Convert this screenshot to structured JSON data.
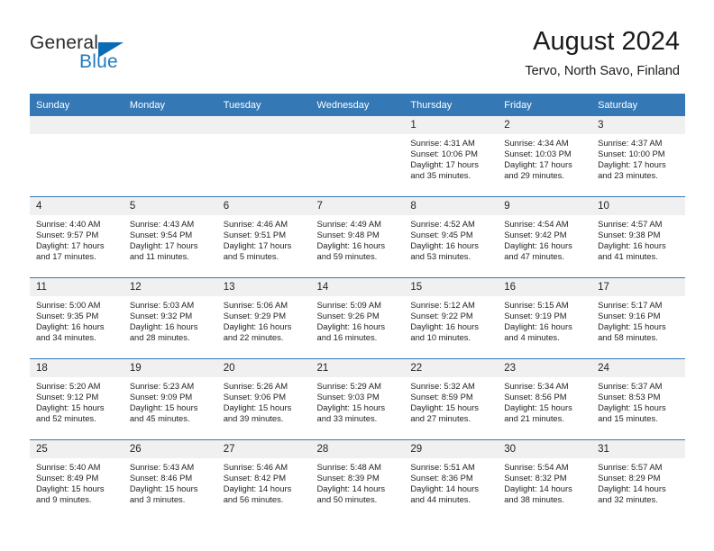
{
  "brand": {
    "name_line1": "General",
    "name_line2": "Blue",
    "accent_color": "#0a6cb5"
  },
  "header": {
    "title": "August 2024",
    "location": "Tervo, North Savo, Finland"
  },
  "theme": {
    "header_blue": "#3478b6",
    "daynum_background": "#f0f0f0",
    "text_color": "#231f20"
  },
  "weekday_headers": [
    "Sunday",
    "Monday",
    "Tuesday",
    "Wednesday",
    "Thursday",
    "Friday",
    "Saturday"
  ],
  "weeks": [
    [
      {
        "day": "",
        "empty": true,
        "sunrise": "",
        "sunset": "",
        "daylight_line1": "",
        "daylight_line2": ""
      },
      {
        "day": "",
        "empty": true,
        "sunrise": "",
        "sunset": "",
        "daylight_line1": "",
        "daylight_line2": ""
      },
      {
        "day": "",
        "empty": true,
        "sunrise": "",
        "sunset": "",
        "daylight_line1": "",
        "daylight_line2": ""
      },
      {
        "day": "",
        "empty": true,
        "sunrise": "",
        "sunset": "",
        "daylight_line1": "",
        "daylight_line2": ""
      },
      {
        "day": "1",
        "sunrise": "Sunrise: 4:31 AM",
        "sunset": "Sunset: 10:06 PM",
        "daylight_line1": "Daylight: 17 hours",
        "daylight_line2": "and 35 minutes."
      },
      {
        "day": "2",
        "sunrise": "Sunrise: 4:34 AM",
        "sunset": "Sunset: 10:03 PM",
        "daylight_line1": "Daylight: 17 hours",
        "daylight_line2": "and 29 minutes."
      },
      {
        "day": "3",
        "sunrise": "Sunrise: 4:37 AM",
        "sunset": "Sunset: 10:00 PM",
        "daylight_line1": "Daylight: 17 hours",
        "daylight_line2": "and 23 minutes."
      }
    ],
    [
      {
        "day": "4",
        "sunrise": "Sunrise: 4:40 AM",
        "sunset": "Sunset: 9:57 PM",
        "daylight_line1": "Daylight: 17 hours",
        "daylight_line2": "and 17 minutes."
      },
      {
        "day": "5",
        "sunrise": "Sunrise: 4:43 AM",
        "sunset": "Sunset: 9:54 PM",
        "daylight_line1": "Daylight: 17 hours",
        "daylight_line2": "and 11 minutes."
      },
      {
        "day": "6",
        "sunrise": "Sunrise: 4:46 AM",
        "sunset": "Sunset: 9:51 PM",
        "daylight_line1": "Daylight: 17 hours",
        "daylight_line2": "and 5 minutes."
      },
      {
        "day": "7",
        "sunrise": "Sunrise: 4:49 AM",
        "sunset": "Sunset: 9:48 PM",
        "daylight_line1": "Daylight: 16 hours",
        "daylight_line2": "and 59 minutes."
      },
      {
        "day": "8",
        "sunrise": "Sunrise: 4:52 AM",
        "sunset": "Sunset: 9:45 PM",
        "daylight_line1": "Daylight: 16 hours",
        "daylight_line2": "and 53 minutes."
      },
      {
        "day": "9",
        "sunrise": "Sunrise: 4:54 AM",
        "sunset": "Sunset: 9:42 PM",
        "daylight_line1": "Daylight: 16 hours",
        "daylight_line2": "and 47 minutes."
      },
      {
        "day": "10",
        "sunrise": "Sunrise: 4:57 AM",
        "sunset": "Sunset: 9:38 PM",
        "daylight_line1": "Daylight: 16 hours",
        "daylight_line2": "and 41 minutes."
      }
    ],
    [
      {
        "day": "11",
        "sunrise": "Sunrise: 5:00 AM",
        "sunset": "Sunset: 9:35 PM",
        "daylight_line1": "Daylight: 16 hours",
        "daylight_line2": "and 34 minutes."
      },
      {
        "day": "12",
        "sunrise": "Sunrise: 5:03 AM",
        "sunset": "Sunset: 9:32 PM",
        "daylight_line1": "Daylight: 16 hours",
        "daylight_line2": "and 28 minutes."
      },
      {
        "day": "13",
        "sunrise": "Sunrise: 5:06 AM",
        "sunset": "Sunset: 9:29 PM",
        "daylight_line1": "Daylight: 16 hours",
        "daylight_line2": "and 22 minutes."
      },
      {
        "day": "14",
        "sunrise": "Sunrise: 5:09 AM",
        "sunset": "Sunset: 9:26 PM",
        "daylight_line1": "Daylight: 16 hours",
        "daylight_line2": "and 16 minutes."
      },
      {
        "day": "15",
        "sunrise": "Sunrise: 5:12 AM",
        "sunset": "Sunset: 9:22 PM",
        "daylight_line1": "Daylight: 16 hours",
        "daylight_line2": "and 10 minutes."
      },
      {
        "day": "16",
        "sunrise": "Sunrise: 5:15 AM",
        "sunset": "Sunset: 9:19 PM",
        "daylight_line1": "Daylight: 16 hours",
        "daylight_line2": "and 4 minutes."
      },
      {
        "day": "17",
        "sunrise": "Sunrise: 5:17 AM",
        "sunset": "Sunset: 9:16 PM",
        "daylight_line1": "Daylight: 15 hours",
        "daylight_line2": "and 58 minutes."
      }
    ],
    [
      {
        "day": "18",
        "sunrise": "Sunrise: 5:20 AM",
        "sunset": "Sunset: 9:12 PM",
        "daylight_line1": "Daylight: 15 hours",
        "daylight_line2": "and 52 minutes."
      },
      {
        "day": "19",
        "sunrise": "Sunrise: 5:23 AM",
        "sunset": "Sunset: 9:09 PM",
        "daylight_line1": "Daylight: 15 hours",
        "daylight_line2": "and 45 minutes."
      },
      {
        "day": "20",
        "sunrise": "Sunrise: 5:26 AM",
        "sunset": "Sunset: 9:06 PM",
        "daylight_line1": "Daylight: 15 hours",
        "daylight_line2": "and 39 minutes."
      },
      {
        "day": "21",
        "sunrise": "Sunrise: 5:29 AM",
        "sunset": "Sunset: 9:03 PM",
        "daylight_line1": "Daylight: 15 hours",
        "daylight_line2": "and 33 minutes."
      },
      {
        "day": "22",
        "sunrise": "Sunrise: 5:32 AM",
        "sunset": "Sunset: 8:59 PM",
        "daylight_line1": "Daylight: 15 hours",
        "daylight_line2": "and 27 minutes."
      },
      {
        "day": "23",
        "sunrise": "Sunrise: 5:34 AM",
        "sunset": "Sunset: 8:56 PM",
        "daylight_line1": "Daylight: 15 hours",
        "daylight_line2": "and 21 minutes."
      },
      {
        "day": "24",
        "sunrise": "Sunrise: 5:37 AM",
        "sunset": "Sunset: 8:53 PM",
        "daylight_line1": "Daylight: 15 hours",
        "daylight_line2": "and 15 minutes."
      }
    ],
    [
      {
        "day": "25",
        "sunrise": "Sunrise: 5:40 AM",
        "sunset": "Sunset: 8:49 PM",
        "daylight_line1": "Daylight: 15 hours",
        "daylight_line2": "and 9 minutes."
      },
      {
        "day": "26",
        "sunrise": "Sunrise: 5:43 AM",
        "sunset": "Sunset: 8:46 PM",
        "daylight_line1": "Daylight: 15 hours",
        "daylight_line2": "and 3 minutes."
      },
      {
        "day": "27",
        "sunrise": "Sunrise: 5:46 AM",
        "sunset": "Sunset: 8:42 PM",
        "daylight_line1": "Daylight: 14 hours",
        "daylight_line2": "and 56 minutes."
      },
      {
        "day": "28",
        "sunrise": "Sunrise: 5:48 AM",
        "sunset": "Sunset: 8:39 PM",
        "daylight_line1": "Daylight: 14 hours",
        "daylight_line2": "and 50 minutes."
      },
      {
        "day": "29",
        "sunrise": "Sunrise: 5:51 AM",
        "sunset": "Sunset: 8:36 PM",
        "daylight_line1": "Daylight: 14 hours",
        "daylight_line2": "and 44 minutes."
      },
      {
        "day": "30",
        "sunrise": "Sunrise: 5:54 AM",
        "sunset": "Sunset: 8:32 PM",
        "daylight_line1": "Daylight: 14 hours",
        "daylight_line2": "and 38 minutes."
      },
      {
        "day": "31",
        "sunrise": "Sunrise: 5:57 AM",
        "sunset": "Sunset: 8:29 PM",
        "daylight_line1": "Daylight: 14 hours",
        "daylight_line2": "and 32 minutes."
      }
    ]
  ]
}
